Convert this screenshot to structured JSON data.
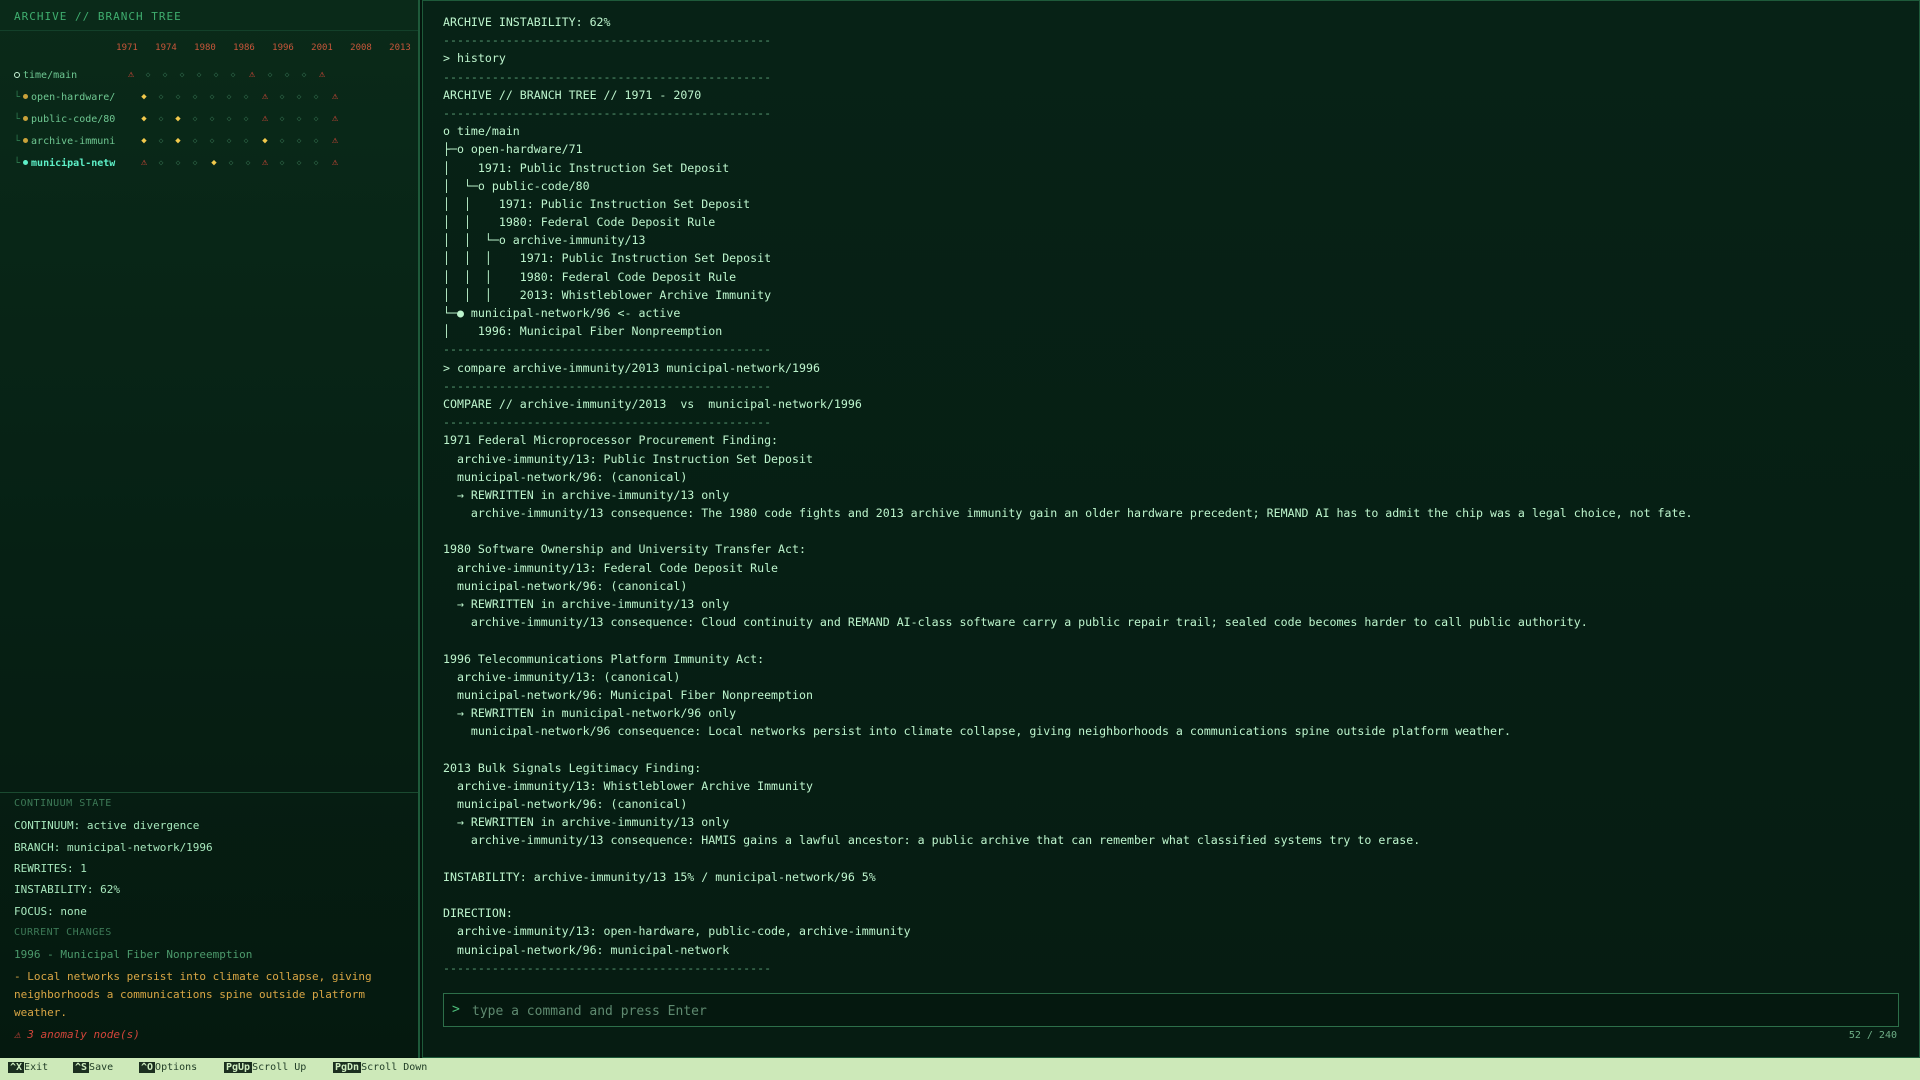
{
  "sidebar": {
    "title": "ARCHIVE // BRANCH TREE",
    "years": [
      "1971",
      "1974",
      "1980",
      "1986",
      "1996",
      "2001",
      "2008",
      "2013"
    ],
    "branches": [
      {
        "label": "time/main",
        "active": false
      },
      {
        "label": "open-hardware/",
        "active": false
      },
      {
        "label": "public-code/80",
        "active": false
      },
      {
        "label": "archive-immuni",
        "active": false
      },
      {
        "label": "municipal-netw",
        "active": true
      }
    ],
    "state": {
      "heading": "CONTINUUM STATE",
      "continuum": "CONTINUUM: active divergence",
      "branch": "BRANCH: municipal-network/1996",
      "rewrites": "REWRITES: 1",
      "instability": "INSTABILITY: 62%",
      "focus": "FOCUS: none",
      "changes_heading": "CURRENT CHANGES",
      "change": "1996 - Municipal Fiber Nonpreemption",
      "consequence": "- Local networks persist into climate collapse, giving neighborhoods a communications spine outside platform weather.",
      "anomaly": "⚠ 3 anomaly node(s)"
    }
  },
  "terminal": {
    "lines": [
      "ARCHIVE INSTABILITY: 62%",
      "-----------------------------------------------",
      "> history",
      "-----------------------------------------------",
      "ARCHIVE // BRANCH TREE // 1971 - 2070",
      "-----------------------------------------------",
      "o time/main",
      "├─o open-hardware/71",
      "│    1971: Public Instruction Set Deposit",
      "│  └─o public-code/80",
      "│  │    1971: Public Instruction Set Deposit",
      "│  │    1980: Federal Code Deposit Rule",
      "│  │  └─o archive-immunity/13",
      "│  │  │    1971: Public Instruction Set Deposit",
      "│  │  │    1980: Federal Code Deposit Rule",
      "│  │  │    2013: Whistleblower Archive Immunity",
      "└─● municipal-network/96 <- active",
      "│    1996: Municipal Fiber Nonpreemption",
      "-----------------------------------------------",
      "> compare archive-immunity/2013 municipal-network/1996",
      "-----------------------------------------------",
      "COMPARE // archive-immunity/2013  vs  municipal-network/1996",
      "-----------------------------------------------",
      "1971 Federal Microprocessor Procurement Finding:",
      "  archive-immunity/13: Public Instruction Set Deposit",
      "  municipal-network/96: (canonical)",
      "  → REWRITTEN in archive-immunity/13 only",
      "    archive-immunity/13 consequence: The 1980 code fights and 2013 archive immunity gain an older hardware precedent; REMAND AI has to admit the chip was a legal choice, not fate.",
      "",
      "1980 Software Ownership and University Transfer Act:",
      "  archive-immunity/13: Federal Code Deposit Rule",
      "  municipal-network/96: (canonical)",
      "  → REWRITTEN in archive-immunity/13 only",
      "    archive-immunity/13 consequence: Cloud continuity and REMAND AI-class software carry a public repair trail; sealed code becomes harder to call public authority.",
      "",
      "1996 Telecommunications Platform Immunity Act:",
      "  archive-immunity/13: (canonical)",
      "  municipal-network/96: Municipal Fiber Nonpreemption",
      "  → REWRITTEN in municipal-network/96 only",
      "    municipal-network/96 consequence: Local networks persist into climate collapse, giving neighborhoods a communications spine outside platform weather.",
      "",
      "2013 Bulk Signals Legitimacy Finding:",
      "  archive-immunity/13: Whistleblower Archive Immunity",
      "  municipal-network/96: (canonical)",
      "  → REWRITTEN in archive-immunity/13 only",
      "    archive-immunity/13 consequence: HAMIS gains a lawful ancestor: a public archive that can remember what classified systems try to erase.",
      "",
      "INSTABILITY: archive-immunity/13 15% / municipal-network/96 5%",
      "",
      "DIRECTION:",
      "  archive-immunity/13: open-hardware, public-code, archive-immunity",
      "  municipal-network/96: municipal-network",
      "-----------------------------------------------"
    ],
    "prompt": ">",
    "input_placeholder": "type a command and press Enter",
    "input_value": "",
    "page_indicator": "52 / 240"
  },
  "statusbar": [
    {
      "key": "^X",
      "label": "Exit"
    },
    {
      "key": "^S",
      "label": "Save"
    },
    {
      "key": "^O",
      "label": "Options"
    },
    {
      "key": "PgUp",
      "label": "Scroll Up"
    },
    {
      "key": "PgDn",
      "label": "Scroll Down"
    }
  ],
  "colors": {
    "background": "#03140c",
    "terminal_text": "#bdf5cd",
    "accent_active": "#5ef0c8",
    "diamond": "#f2c94c",
    "anomaly": "#e04a3a",
    "statusbar_bg": "#cde9b9"
  }
}
